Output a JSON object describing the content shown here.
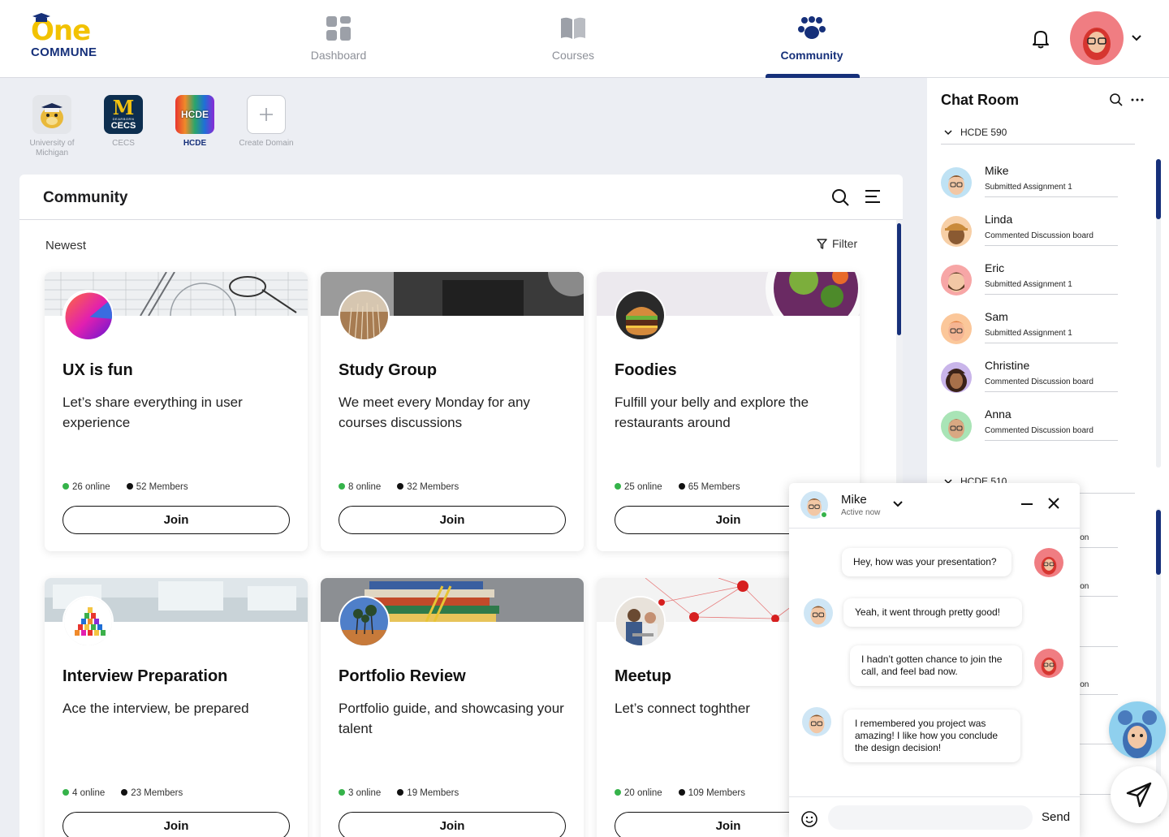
{
  "app": {
    "logo_text": "One",
    "logo_sub": "COMMUNE"
  },
  "nav": {
    "tabs": [
      {
        "label": "Dashboard",
        "icon": "dashboard-grid-icon",
        "active": false
      },
      {
        "label": "Courses",
        "icon": "book-icon",
        "active": false
      },
      {
        "label": "Community",
        "icon": "people-group-icon",
        "active": true
      }
    ]
  },
  "domains": [
    {
      "label": "University of Michigan",
      "active": false
    },
    {
      "label": "CECS",
      "active": false,
      "tile_text": "M",
      "tile_sub": "DEARBORN",
      "tile_sub2": "CECS"
    },
    {
      "label": "HCDE",
      "active": true,
      "tile_text": "HCDE"
    },
    {
      "label": "Create Domain",
      "active": false
    }
  ],
  "community": {
    "title": "Community",
    "sort_label": "Newest",
    "filter_label": "Filter",
    "join_label": "Join",
    "cards": [
      {
        "title": "UX is fun",
        "description": "Let’s share everything in user experience",
        "online": "26 online",
        "members": "52 Members"
      },
      {
        "title": "Study Group",
        "description": "We meet every Monday for any courses discussions",
        "online": "8 online",
        "members": "32 Members"
      },
      {
        "title": "Foodies",
        "description": "Fulfill your belly and explore the restaurants around",
        "online": "25 online",
        "members": "65 Members"
      },
      {
        "title": "Interview Preparation",
        "description": "Ace the interview, be prepared",
        "online": "4 online",
        "members": "23 Members"
      },
      {
        "title": "Portfolio Review",
        "description": "Portfolio guide, and showcasing your talent",
        "online": "3 online",
        "members": "19 Members"
      },
      {
        "title": "Meetup",
        "description": "Let’s connect toghther",
        "online": "20 online",
        "members": "109 Members"
      }
    ]
  },
  "chat_room": {
    "title": "Chat Room",
    "group1": "HCDE 590",
    "group2": "HCDE 510",
    "people": [
      {
        "name": "Mike",
        "activity": "Submitted Assignment 1"
      },
      {
        "name": "Linda",
        "activity": "Commented Discussion board"
      },
      {
        "name": "Eric",
        "activity": "Submitted Assignment 1"
      },
      {
        "name": "Sam",
        "activity": "Submitted Assignment 1"
      },
      {
        "name": "Christine",
        "activity": "Commented Discussion board"
      },
      {
        "name": "Anna",
        "activity": "Commented Discussion board"
      }
    ],
    "partial_suffix": "ion"
  },
  "chat_popup": {
    "name": "Mike",
    "status": "Active now",
    "messages": [
      {
        "from": "me",
        "text": "Hey, how was your presentation?"
      },
      {
        "from": "mike",
        "text": "Yeah, it went through pretty good!"
      },
      {
        "from": "me",
        "text": "I hadn’t gotten chance to join the call, and feel bad now."
      },
      {
        "from": "mike",
        "text": "I remembered you project was amazing! I like how you conclude the design decision!"
      }
    ],
    "input_value": "",
    "send_label": "Send"
  },
  "colors": {
    "brand_navy": "#16307a",
    "brand_yellow": "#f2c200",
    "online_green": "#35b34a",
    "background": "#eceef3"
  }
}
